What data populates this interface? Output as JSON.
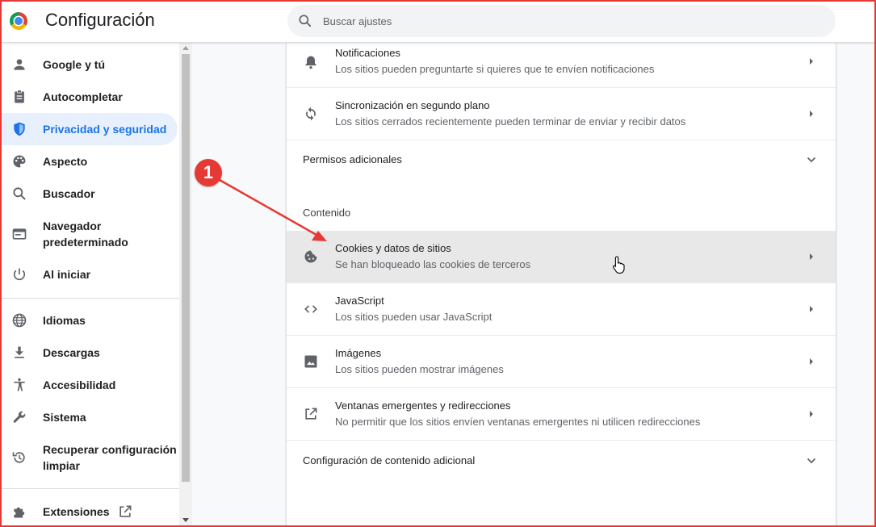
{
  "app": {
    "title": "Configuración",
    "search_placeholder": "Buscar ajustes"
  },
  "sidebar": {
    "items": [
      {
        "label": "Google y tú",
        "icon": "person-icon"
      },
      {
        "label": "Autocompletar",
        "icon": "clipboard-icon"
      },
      {
        "label": "Privacidad y seguridad",
        "icon": "shield-icon",
        "active": true
      },
      {
        "label": "Aspecto",
        "icon": "palette-icon"
      },
      {
        "label": "Buscador",
        "icon": "search-icon"
      },
      {
        "label": "Navegador\npredeterminado",
        "icon": "browser-icon"
      },
      {
        "label": "Al iniciar",
        "icon": "power-icon"
      },
      {
        "label": "Idiomas",
        "icon": "globe-icon"
      },
      {
        "label": "Descargas",
        "icon": "download-icon"
      },
      {
        "label": "Accesibilidad",
        "icon": "accessibility-icon"
      },
      {
        "label": "Sistema",
        "icon": "wrench-icon"
      },
      {
        "label": "Recuperar configuración y\nlimpiar",
        "icon": "restore-icon"
      },
      {
        "label": "Extensiones",
        "icon": "puzzle-icon"
      }
    ]
  },
  "content": {
    "rows_top": [
      {
        "title": "Notificaciones",
        "subtitle": "Los sitios pueden preguntarte si quieres que te envíen notificaciones",
        "icon": "bell-icon"
      },
      {
        "title": "Sincronización en segundo plano",
        "subtitle": "Los sitios cerrados recientemente pueden terminar de enviar y recibir datos",
        "icon": "sync-icon"
      }
    ],
    "additional_permissions": "Permisos adicionales",
    "content_header": "Contenido",
    "rows_content": [
      {
        "title": "Cookies y datos de sitios",
        "subtitle": "Se han bloqueado las cookies de terceros",
        "icon": "cookie-icon",
        "highlighted": true
      },
      {
        "title": "JavaScript",
        "subtitle": "Los sitios pueden usar JavaScript",
        "icon": "code-icon"
      },
      {
        "title": "Imágenes",
        "subtitle": "Los sitios pueden mostrar imágenes",
        "icon": "image-icon"
      },
      {
        "title": "Ventanas emergentes y redirecciones",
        "subtitle": "No permitir que los sitios envíen ventanas emergentes ni utilicen redirecciones",
        "icon": "open-external-icon"
      }
    ],
    "additional_content": "Configuración de contenido adicional"
  },
  "annotation": {
    "label": "1",
    "color": "#e53935"
  },
  "colors": {
    "accent": "#1a73e8",
    "active_bg": "#e8f0fe",
    "highlight_row": "#e8e8e8"
  }
}
